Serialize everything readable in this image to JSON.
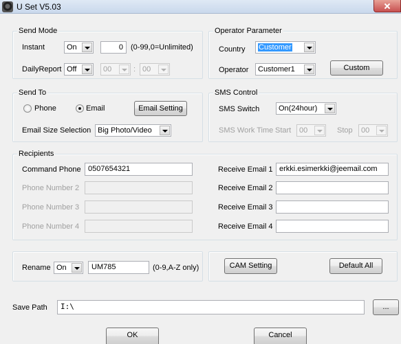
{
  "window": {
    "title": "U Set V5.03"
  },
  "send_mode": {
    "title": "Send Mode",
    "instant_label": "Instant",
    "instant_value": "On",
    "count_value": "0",
    "count_hint": "(0-99,0=Unlimited)",
    "daily_report_label": "DailyReport",
    "daily_report_value": "Off",
    "hour_value": "00",
    "time_separator": ":",
    "minute_value": "00"
  },
  "operator": {
    "title": "Operator Parameter",
    "country_label": "Country",
    "country_value": "Customer",
    "operator_label": "Operator",
    "operator_value": "Customer1",
    "custom_button": "Custom"
  },
  "send_to": {
    "title": "Send To",
    "phone_label": "Phone",
    "email_label": "Email",
    "selected": "Email",
    "email_setting_button": "Email Setting",
    "email_size_label": "Email Size Selection",
    "email_size_value": "Big Photo/Video"
  },
  "sms": {
    "title": "SMS Control",
    "switch_label": "SMS Switch",
    "switch_value": "On(24hour)",
    "work_time_label": "SMS Work Time",
    "start_label": "Start",
    "start_value": "00",
    "stop_label": "Stop",
    "stop_value": "00"
  },
  "recipients": {
    "title": "Recipients",
    "command_phone_label": "Command Phone",
    "command_phone_value": "0507654321",
    "phone2_label": "Phone Number 2",
    "phone3_label": "Phone Number 3",
    "phone4_label": "Phone Number 4",
    "email1_label": "Receive Email 1",
    "email1_value": "erkki.esimerkki@jeemail.com",
    "email2_label": "Receive Email 2",
    "email3_label": "Receive Email 3",
    "email4_label": "Receive Email 4"
  },
  "rename": {
    "label": "Rename",
    "toggle_value": "On",
    "name_value": "UM785",
    "hint": "(0-9,A-Z only)"
  },
  "buttons": {
    "cam_setting": "CAM Setting",
    "default_all": "Default All",
    "browse": "...",
    "ok": "OK",
    "cancel": "Cancel"
  },
  "save_path": {
    "label": "Save Path",
    "value": "I:\\"
  }
}
